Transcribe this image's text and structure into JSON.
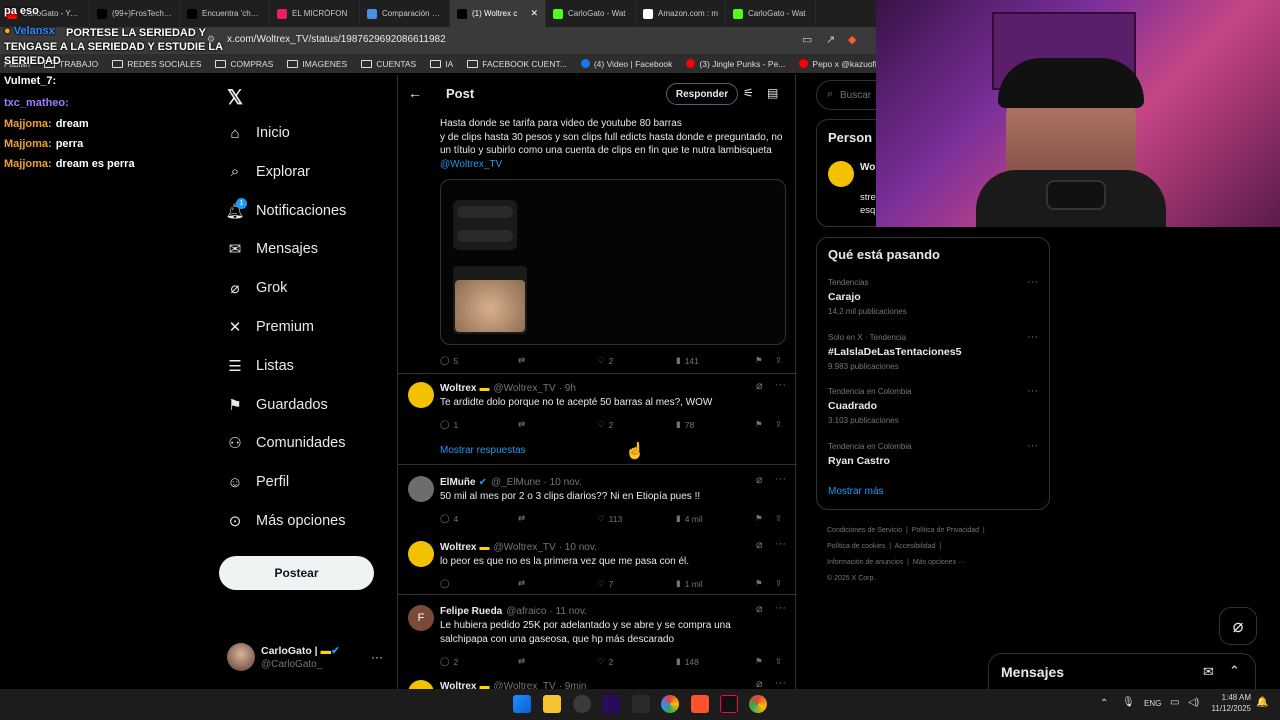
{
  "browser": {
    "tabs": [
      {
        "label": "CarloGato - YouTu",
        "color": "#ff0000"
      },
      {
        "label": "(99+)FrosTech (@",
        "color": "#000000"
      },
      {
        "label": "Encuentra 'chanty",
        "color": "#000000"
      },
      {
        "label": "EL MICRÓFON",
        "color": "#e91e63"
      },
      {
        "label": "Comparación pre",
        "color": "#4a90e2"
      },
      {
        "label": "(1) Woltrex c",
        "color": "#000000",
        "active": true
      },
      {
        "label": "CarloGato - Wat",
        "color": "#53fc18"
      },
      {
        "label": "Amazon.com : m",
        "color": "#ffffff"
      },
      {
        "label": "CarloGato - Wat",
        "color": "#53fc18"
      }
    ],
    "url": "x.com/Woltrex_TV/status/1987629692086611982",
    "bookmarks": [
      {
        "label": "Fabian",
        "kind": "text"
      },
      {
        "label": "TRABAJO",
        "kind": "folder"
      },
      {
        "label": "REDES SOCIALES",
        "kind": "folder"
      },
      {
        "label": "COMPRAS",
        "kind": "folder"
      },
      {
        "label": "IMAGENES",
        "kind": "folder"
      },
      {
        "label": "CUENTAS",
        "kind": "folder"
      },
      {
        "label": "IA",
        "kind": "folder"
      },
      {
        "label": "FACEBOOK CUENT...",
        "kind": "folder"
      },
      {
        "label": "(4) Video | Facebook",
        "kind": "fb"
      },
      {
        "label": "(3) Jingle Punks - Pe...",
        "kind": "yt"
      },
      {
        "label": "Pepo x @kazuoficia...",
        "kind": "yt"
      }
    ]
  },
  "chat_overlay": {
    "top_partial": "pa eso",
    "alert_user": "Velansx",
    "alert_message": "PORTESE LA SERIEDAD Y TENGASE A LA SERIEDAD Y ESTUDIE LA SERIEDAD",
    "lines": [
      {
        "user": "Vulmet_7:",
        "text": "",
        "color": "#ffffff"
      },
      {
        "user": "txc_matheo:",
        "text": "",
        "color": "#9e7bff"
      },
      {
        "user": "Majjoma:",
        "text": "dream",
        "color": "#f0a030"
      },
      {
        "user": "Majjoma:",
        "text": "perra",
        "color": "#f0a030"
      },
      {
        "user": "Majjoma:",
        "text": "dream es perra",
        "color": "#f0a030"
      }
    ]
  },
  "nav": {
    "logo": "x-logo-icon",
    "items": [
      {
        "label": "Inicio",
        "icon": "home-icon"
      },
      {
        "label": "Explorar",
        "icon": "search-icon"
      },
      {
        "label": "Notificaciones",
        "icon": "bell-icon",
        "badge": "1"
      },
      {
        "label": "Mensajes",
        "icon": "mail-icon"
      },
      {
        "label": "Grok",
        "icon": "grok-icon"
      },
      {
        "label": "Premium",
        "icon": "x-icon"
      },
      {
        "label": "Listas",
        "icon": "list-icon"
      },
      {
        "label": "Guardados",
        "icon": "bookmark-icon"
      },
      {
        "label": "Comunidades",
        "icon": "people-icon"
      },
      {
        "label": "Perfil",
        "icon": "person-icon"
      },
      {
        "label": "Más opciones",
        "icon": "more-circle-icon"
      }
    ],
    "post_button": "Postear",
    "account": {
      "name": "CarloGato |",
      "handle": "@CarloGato_"
    }
  },
  "post": {
    "header_title": "Post",
    "reply_button": "Responder",
    "main_text": "Hasta donde se tarifa para video de youtube 80 barras\ny de clips hasta 30 pesos y son clips full edicts hasta donde e preguntado, no un título y subirlo como una cuenta de clips en fin que te nutra lambisqueta ",
    "mention": "@Woltrex_TV",
    "stats": {
      "replies": "5",
      "retweets": "",
      "likes": "2",
      "views": "141"
    },
    "show_replies": "Mostrar respuestas",
    "replies": [
      {
        "name": "Woltrex",
        "handle": "@Woltrex_TV",
        "time": "· 9h",
        "text": "Te ardidte dolo porque no te acepté 50 barras al mes?, WOW",
        "r": "1",
        "rt": "",
        "l": "2",
        "v": "78",
        "avatar": "#f2c200"
      },
      {
        "name": "ElMuñe",
        "handle": "@_ElMune",
        "time": "· 10 nov.",
        "text": "50 mil al mes por 2 o 3 clips diarios?? Ni en Etiopía pues !!",
        "r": "4",
        "rt": "",
        "l": "113",
        "v": "4 mil",
        "avatar": "#6d6d6d",
        "verified": true
      },
      {
        "name": "Woltrex",
        "handle": "@Woltrex_TV",
        "time": "· 10 nov.",
        "text": "lo peor es que no es la primera vez que me pasa con él.",
        "r": "",
        "rt": "",
        "l": "7",
        "v": "1 mil",
        "avatar": "#f2c200"
      },
      {
        "name": "Felipe Rueda",
        "handle": "@afraico",
        "time": "· 11 nov.",
        "text": "Le hubiera pedido 25K por adelantado y se abre y se compra una salchipapa con una gaseosa, que hp más descarado",
        "r": "2",
        "rt": "",
        "l": "2",
        "v": "148",
        "avatar": "#7a4b3a",
        "initial": "F"
      },
      {
        "name": "Woltrex",
        "handle": "@Woltrex_TV",
        "time": "· 9min",
        "text": "",
        "avatar": "#f2c200"
      }
    ]
  },
  "right": {
    "search_placeholder": "Buscar",
    "persona_title": "Person",
    "persona_name": "Wo",
    "persona_lines": [
      "stre",
      "esq"
    ],
    "trends_title": "Qué está pasando",
    "trends": [
      {
        "context": "Tendencias",
        "name": "Carajo",
        "count": "14,2 mil publicaciones"
      },
      {
        "context": "Solo en X · Tendencia",
        "name": "#LaIslaDeLasTentaciones5",
        "count": "9.983 publicaciones"
      },
      {
        "context": "Tendencia en Colombia",
        "name": "Cuadrado",
        "count": "3.103 publicaciones"
      },
      {
        "context": "Tendencia en Colombia",
        "name": "Ryan Castro",
        "count": ""
      }
    ],
    "show_more": "Mostrar más",
    "footer": [
      "Condiciones de Servicio",
      "Política de Privacidad",
      "Política de cookies",
      "Accesibilidad",
      "Información de anuncios",
      "Más opciones ···",
      "© 2025 X Corp."
    ],
    "messages_label": "Mensajes"
  },
  "taskbar": {
    "lang": "ENG",
    "time": "1:48 AM",
    "date": "11/12/2025"
  },
  "colors": {
    "accent": "#1d9bf0",
    "bg": "#000000",
    "border": "#2f3336",
    "muted": "#71767b"
  }
}
